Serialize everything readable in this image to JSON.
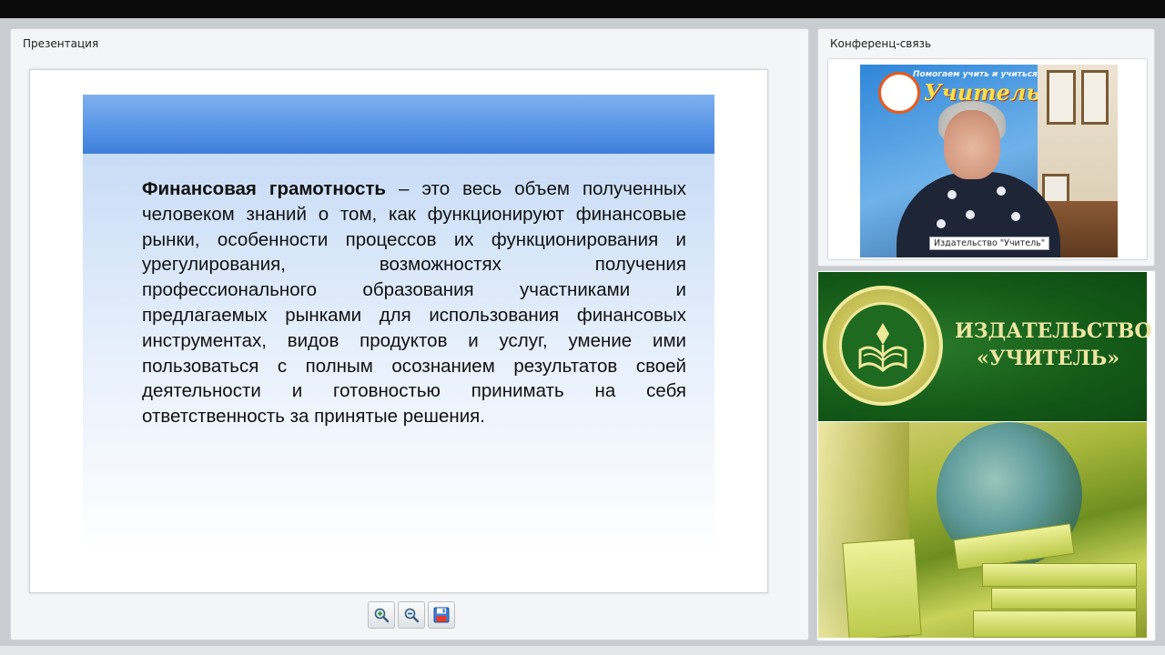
{
  "presentation": {
    "title": "Презентация",
    "slide": {
      "bold_term": "Финансовая грамотность",
      "body": " – это весь объем полученных человеком знаний о том, как функционируют финансовые рынки, особенности процессов их функционирования и урегулирования, возможностях получения профессионального образования участниками и предлагаемых рынками для использования финансовых инструментах, видов продуктов и услуг, умение ими пользоваться с полным осознанием результатов своей деятельности и готовностью принимать на себя ответственность за принятые решения."
    },
    "toolbar": {
      "zoom_in_icon": "zoom-in-icon",
      "zoom_out_icon": "zoom-out-icon",
      "save_icon": "floppy-disk-icon"
    }
  },
  "conference": {
    "title": "Конференц-связь",
    "video": {
      "participant_label": "Издательство \"Учитель\"",
      "poster_tagline": "Помогаем учить и учиться",
      "poster_logo": "Учитель"
    }
  },
  "publisher_banner": {
    "line1": "ИЗДАТЕЛЬСТВО",
    "line2": "«УЧИТЕЛЬ»",
    "colors": {
      "green": "#145a18",
      "gold": "#ece6a2"
    }
  }
}
